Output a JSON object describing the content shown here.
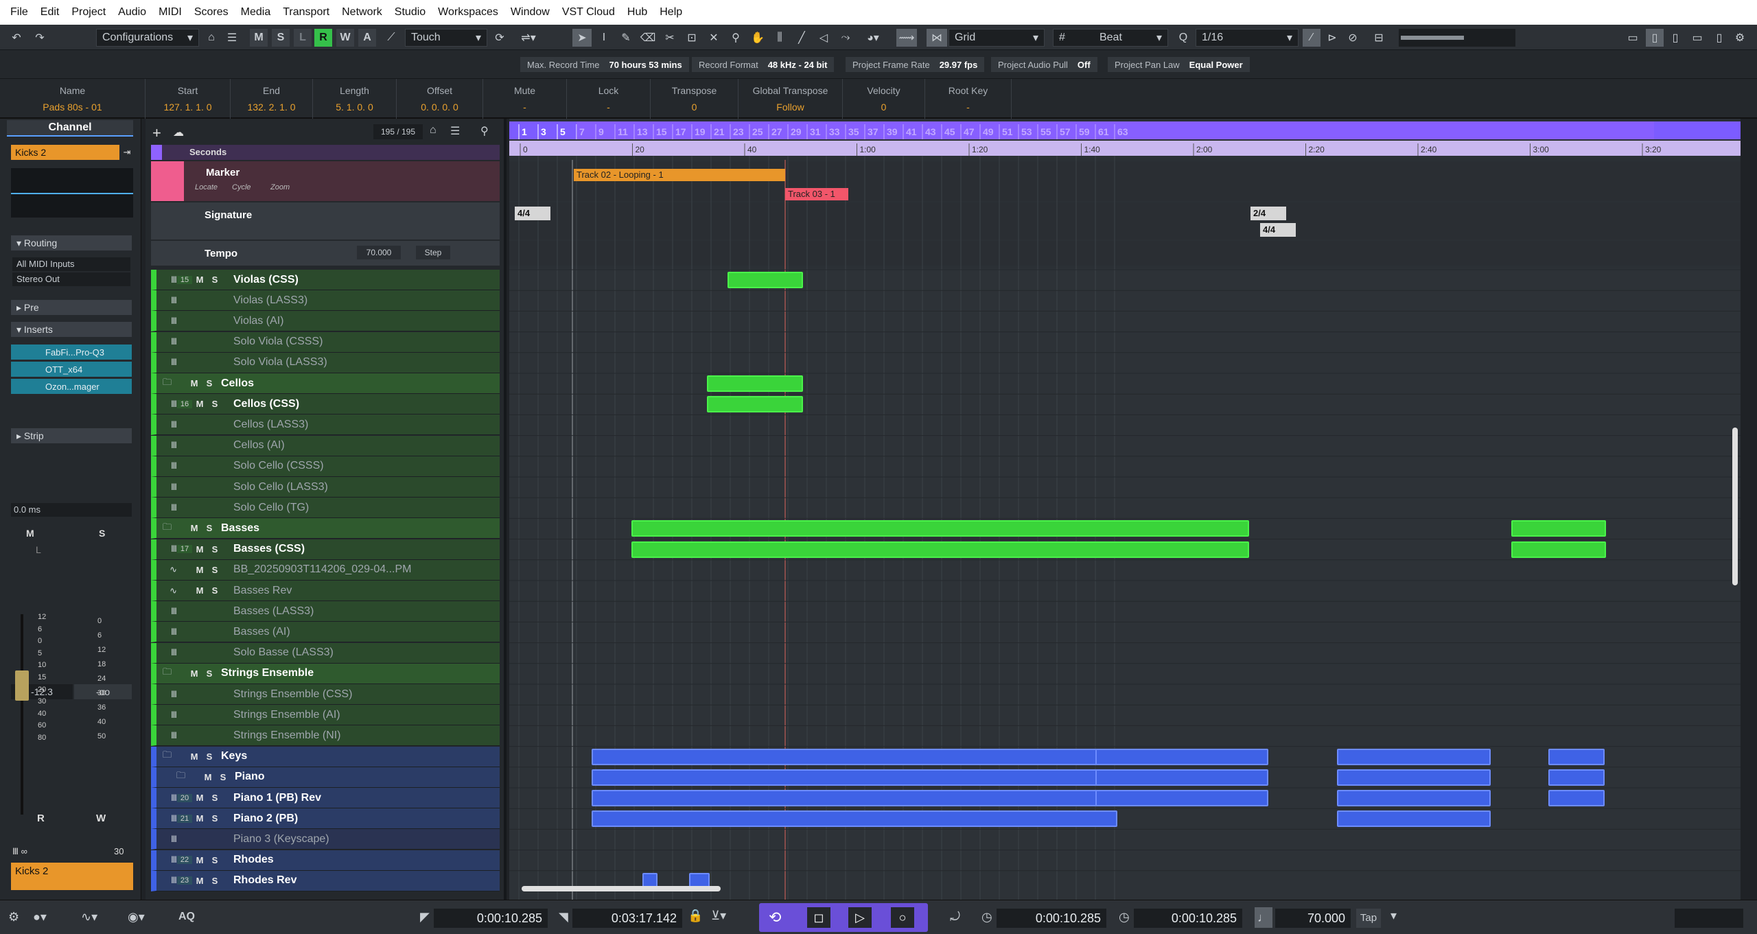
{
  "menu": [
    "File",
    "Edit",
    "Project",
    "Audio",
    "MIDI",
    "Scores",
    "Media",
    "Transport",
    "Network",
    "Studio",
    "Workspaces",
    "Window",
    "VST Cloud",
    "Hub",
    "Help"
  ],
  "toolbar": {
    "configurations": "Configurations",
    "m": "M",
    "s": "S",
    "l": "L",
    "r": "R",
    "w": "W",
    "a": "A",
    "automation_mode": "Touch",
    "snap_type": "Grid",
    "grid_type": "Beat",
    "quantize": "1/16"
  },
  "status": {
    "max_record_label": "Max. Record Time",
    "max_record_value": "70 hours 53 mins",
    "format_label": "Record Format",
    "format_value": "48 kHz - 24 bit",
    "fps_label": "Project Frame Rate",
    "fps_value": "29.97 fps",
    "pull_label": "Project Audio Pull",
    "pull_value": "Off",
    "panlaw_label": "Project Pan Law",
    "panlaw_value": "Equal Power"
  },
  "info": {
    "name_l": "Name",
    "name_v": "Pads 80s - 01",
    "start_l": "Start",
    "start_v": "127. 1. 1. 0",
    "end_l": "End",
    "end_v": "132. 2. 1. 0",
    "length_l": "Length",
    "length_v": "5. 1. 0. 0",
    "offset_l": "Offset",
    "offset_v": "0. 0. 0. 0",
    "mute_l": "Mute",
    "mute_v": "-",
    "lock_l": "Lock",
    "lock_v": "-",
    "transpose_l": "Transpose",
    "transpose_v": "0",
    "gt_l": "Global Transpose",
    "gt_v": "Follow",
    "velocity_l": "Velocity",
    "velocity_v": "0",
    "root_l": "Root Key",
    "root_v": "-"
  },
  "inspector": {
    "tab": "Channel",
    "track_name": "Kicks 2",
    "routing": "Routing",
    "midi_in": "All MIDI Inputs",
    "out": "Stereo Out",
    "pre": "Pre",
    "inserts": "Inserts",
    "plugins": [
      "FabFi...Pro-Q3",
      "OTT_x64",
      "Ozon...mager"
    ],
    "strip": "Strip",
    "delay": "0.0 ms",
    "m": "M",
    "s": "S",
    "l": "L",
    "fader_val": "-12.3",
    "peak": "-oo",
    "r": "R",
    "w": "W",
    "bottom_val": "30",
    "bottom_name": "Kicks 2",
    "scale_l": [
      "12",
      "6",
      "0",
      "5",
      "10",
      "15",
      "20",
      "30",
      "40",
      "60",
      "80"
    ],
    "scale_r": [
      "0",
      "6",
      "12",
      "18",
      "24",
      "30",
      "36",
      "40",
      "50"
    ]
  },
  "tracklist": {
    "counter": "195 / 195"
  },
  "rulers": {
    "top": "Seconds",
    "tracks": [
      {
        "name": "Marker",
        "sub": [
          "Locate",
          "Cycle",
          "Zoom"
        ]
      },
      {
        "name": "Signature"
      },
      {
        "name": "Tempo",
        "value": "70.000",
        "mode": "Step"
      }
    ]
  },
  "tracks": [
    {
      "name": "Violas (CSS)",
      "num": "15",
      "kind": "midi",
      "ms": true,
      "active": true
    },
    {
      "name": "Violas (LASS3)",
      "kind": "midi",
      "active": false
    },
    {
      "name": "Violas (AI)",
      "kind": "midi",
      "active": false
    },
    {
      "name": "Solo Viola (CSSS)",
      "kind": "midi",
      "active": false
    },
    {
      "name": "Solo Viola (LASS3)",
      "kind": "midi",
      "active": false
    },
    {
      "name": "Cellos",
      "kind": "folder",
      "ms": true,
      "active": true
    },
    {
      "name": "Cellos (CSS)",
      "num": "16",
      "kind": "midi",
      "ms": true,
      "active": true
    },
    {
      "name": "Cellos (LASS3)",
      "kind": "midi",
      "active": false
    },
    {
      "name": "Cellos (AI)",
      "kind": "midi",
      "active": false
    },
    {
      "name": "Solo Cello (CSSS)",
      "kind": "midi",
      "active": false
    },
    {
      "name": "Solo Cello (LASS3)",
      "kind": "midi",
      "active": false
    },
    {
      "name": "Solo Cello (TG)",
      "kind": "midi",
      "active": false
    },
    {
      "name": "Basses",
      "kind": "folder",
      "ms": true,
      "active": true
    },
    {
      "name": "Basses (CSS)",
      "num": "17",
      "kind": "midi",
      "ms": true,
      "active": true
    },
    {
      "name": "BB_20250903T114206_029-04...PM",
      "kind": "audio",
      "ms": true,
      "active": false
    },
    {
      "name": "Basses Rev",
      "kind": "audio",
      "ms": true,
      "active": false
    },
    {
      "name": "Basses (LASS3)",
      "kind": "midi",
      "active": false
    },
    {
      "name": "Basses (AI)",
      "kind": "midi",
      "active": false
    },
    {
      "name": "Solo Basse (LASS3)",
      "kind": "midi",
      "active": false
    },
    {
      "name": "Strings Ensemble",
      "kind": "folder",
      "ms": true,
      "active": true
    },
    {
      "name": "Strings Ensemble (CSS)",
      "kind": "midi",
      "active": false
    },
    {
      "name": "Strings Ensemble (AI)",
      "kind": "midi",
      "active": false
    },
    {
      "name": "Strings Ensemble (NI)",
      "kind": "midi",
      "active": false
    },
    {
      "name": "Keys",
      "kind": "folder",
      "ms": true,
      "active": true,
      "blue": true
    },
    {
      "name": "Piano",
      "kind": "folder",
      "ms": true,
      "active": true,
      "blue": true
    },
    {
      "name": "Piano 1 (PB) Rev",
      "num": "20",
      "kind": "midi",
      "ms": true,
      "active": true,
      "blue": true
    },
    {
      "name": "Piano 2 (PB)",
      "num": "21",
      "kind": "midi",
      "ms": true,
      "active": true,
      "blue": true
    },
    {
      "name": "Piano 3 (Keyscape)",
      "kind": "midi",
      "active": false,
      "blue": true
    },
    {
      "name": "Rhodes",
      "num": "22",
      "kind": "midi",
      "ms": true,
      "active": true,
      "blue": true
    },
    {
      "name": "Rhodes Rev",
      "num": "23",
      "kind": "midi",
      "ms": true,
      "active": true,
      "blue": true
    }
  ],
  "bar_ruler": [
    "1",
    "3",
    "5",
    "7",
    "9",
    "11",
    "13",
    "15",
    "17",
    "19",
    "21",
    "23",
    "25",
    "27",
    "29",
    "31",
    "33",
    "35",
    "37",
    "39",
    "41",
    "43",
    "45",
    "47",
    "49",
    "51",
    "53",
    "55",
    "57",
    "59",
    "61",
    "63"
  ],
  "time_ruler": [
    "0",
    "20",
    "40",
    "1:00",
    "1:20",
    "1:40",
    "2:00",
    "2:20",
    "2:40",
    "3:00",
    "3:20"
  ],
  "markers": [
    "Track 02 - Looping -  1",
    "Track 03 -  1"
  ],
  "signatures": [
    "4/4",
    "2/4",
    "4/4"
  ],
  "transport": {
    "left_locator": "0:00:10.285",
    "right_locator": "0:03:17.142",
    "position": "0:00:10.285",
    "secondary": "0:00:10.285",
    "tempo": "70.000",
    "tap": "Tap",
    "aq": "AQ"
  },
  "colors": {
    "accent": "#7c5cff",
    "ruler_purple": "#8f62ff",
    "green_event": "#3ad43a",
    "blue_event": "#3f62e6",
    "marker_orange": "#e8962a",
    "marker_red": "#f2566a",
    "folder_green": "#2f6b32"
  }
}
